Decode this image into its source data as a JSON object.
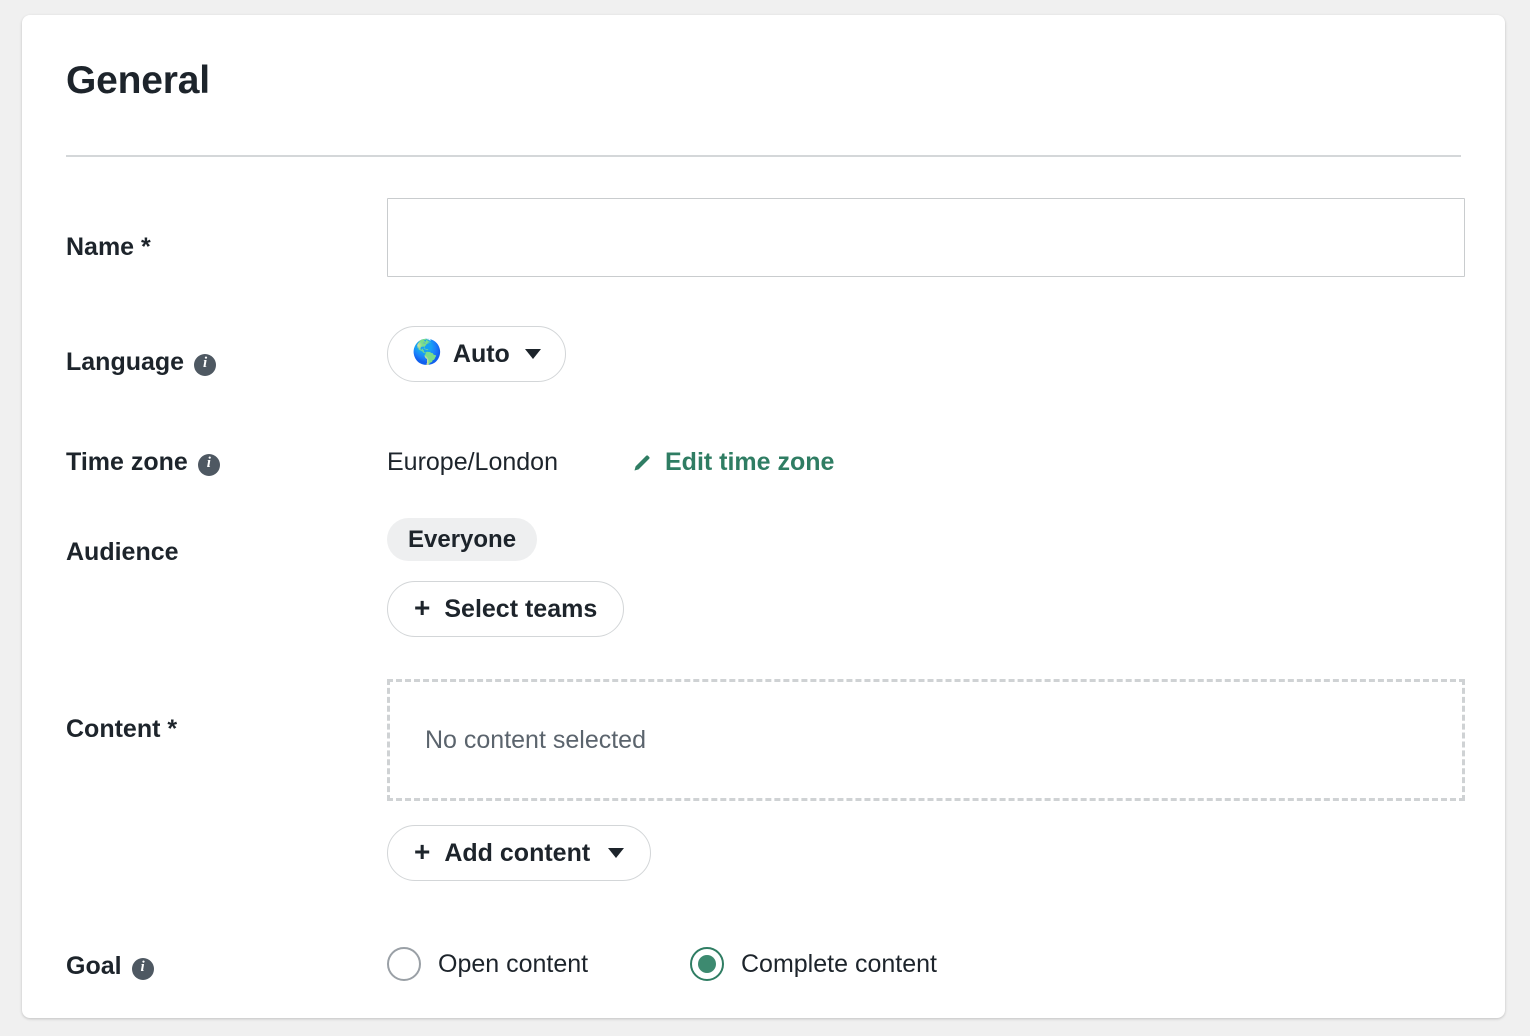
{
  "card": {
    "title": "General"
  },
  "fields": {
    "name": {
      "label": "Name *",
      "value": "",
      "placeholder": ""
    },
    "language": {
      "label": "Language",
      "info_icon": "info-icon",
      "selected": "Auto",
      "globe_icon": "globe-icon",
      "caret_icon": "chevron-down-icon"
    },
    "time_zone": {
      "label": "Time zone",
      "info_icon": "info-icon",
      "value": "Europe/London",
      "edit_link": "Edit time zone",
      "pencil_icon": "pencil-icon"
    },
    "audience": {
      "label": "Audience",
      "chip": "Everyone",
      "select_teams_button": "Select teams",
      "plus_icon": "plus-icon"
    },
    "content": {
      "label": "Content *",
      "empty_text": "No content selected",
      "add_content_button": "Add content",
      "plus_icon": "plus-icon",
      "caret_icon": "chevron-down-icon"
    },
    "goal": {
      "label": "Goal",
      "info_icon": "info-icon",
      "options": [
        {
          "label": "Open content",
          "selected": false
        },
        {
          "label": "Complete content",
          "selected": true
        }
      ]
    }
  },
  "colors": {
    "accent_green": "#2f7d63",
    "text_primary": "#1d242b",
    "text_muted": "#5b646d",
    "border": "#d3d6d8",
    "chip_bg": "#eeeff0",
    "page_bg": "#f0f0f0"
  }
}
